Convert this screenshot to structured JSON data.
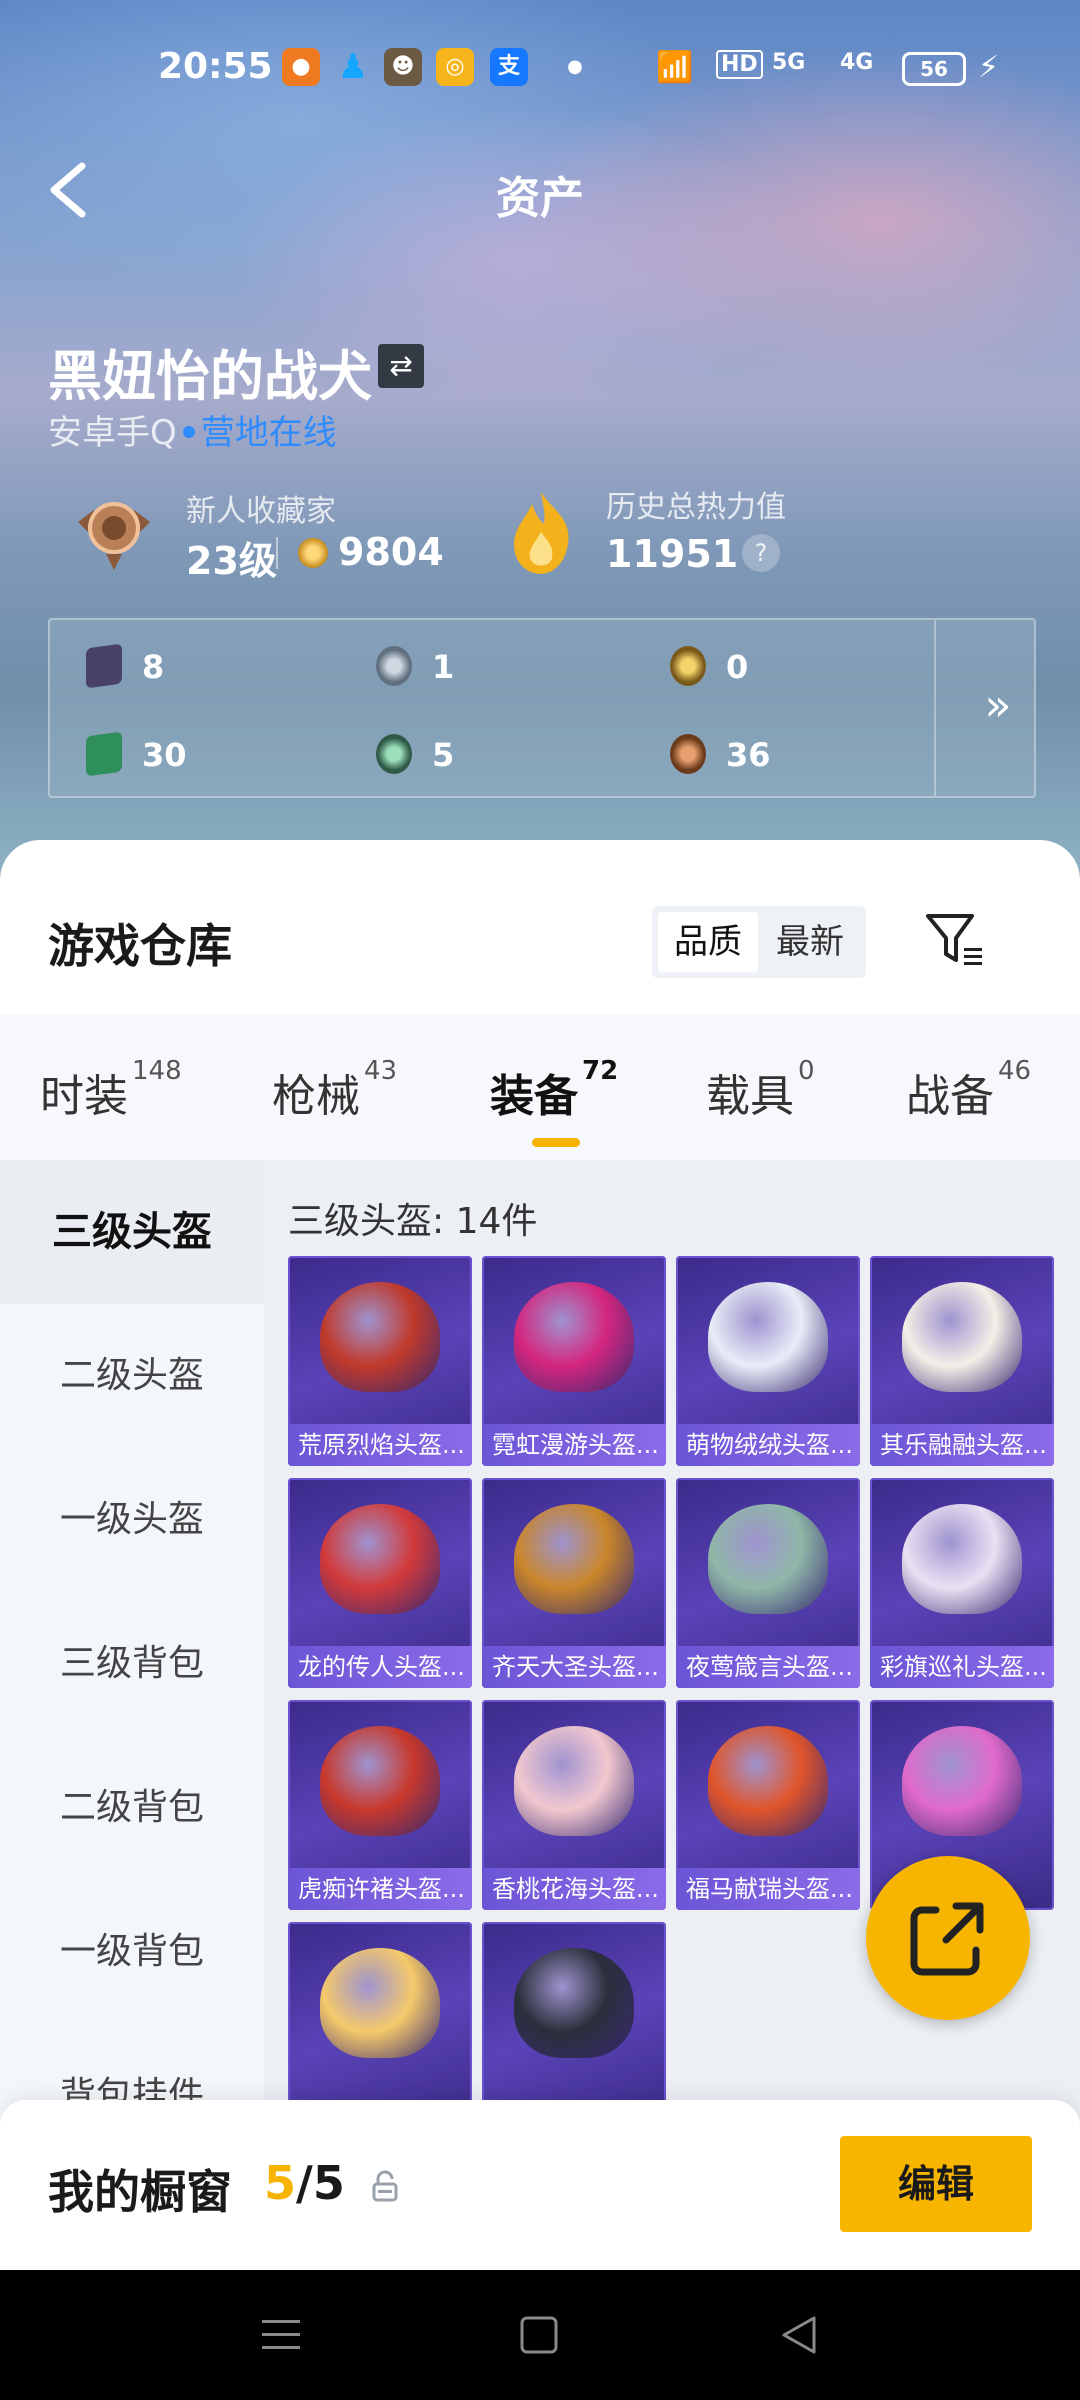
{
  "status": {
    "time": "20:55",
    "battery": "56",
    "network": [
      "HD",
      "5G",
      "4G"
    ]
  },
  "header": {
    "title": "资产",
    "back_icon": "back-arrow-icon"
  },
  "profile": {
    "username": "黑妞怡的战犬",
    "platform": "安卓手Q",
    "status": "营地在线",
    "rank_title": "新人收藏家",
    "rank_level": "23级",
    "rank_points": "9804",
    "heat_title": "历史总热力值",
    "heat_value": "11951",
    "help": "?"
  },
  "assets": [
    {
      "icon": "card-purple-icon",
      "value": "8",
      "color": "#4a4266"
    },
    {
      "icon": "coin-silver-icon",
      "value": "1",
      "color": "#5f6f80"
    },
    {
      "icon": "coin-gold-icon",
      "value": "0",
      "color": "#9a7a2a"
    },
    {
      "icon": "card-green-icon",
      "value": "30",
      "color": "#2f8f5a"
    },
    {
      "icon": "orb-green-icon",
      "value": "5",
      "color": "#3a8060"
    },
    {
      "icon": "coin-bronze-icon",
      "value": "36",
      "color": "#9a5a2a"
    }
  ],
  "warehouse": {
    "title": "游戏仓库",
    "sort": [
      "品质",
      "最新"
    ],
    "active_sort": "品质",
    "tabs": [
      {
        "label": "时装",
        "count": "148"
      },
      {
        "label": "枪械",
        "count": "43"
      },
      {
        "label": "装备",
        "count": "72"
      },
      {
        "label": "载具",
        "count": "0"
      },
      {
        "label": "战备",
        "count": "46"
      }
    ],
    "active_tab": "装备",
    "categories": [
      "三级头盔",
      "二级头盔",
      "一级头盔",
      "三级背包",
      "二级背包",
      "一级背包",
      "背包挂件"
    ],
    "active_category": "三级头盔",
    "grid_title": "三级头盔: 14件",
    "items": [
      {
        "label": "荒原烈焰头盔...",
        "color": "#c0392b"
      },
      {
        "label": "霓虹漫游头盔...",
        "color": "#d4267e"
      },
      {
        "label": "萌物绒绒头盔...",
        "color": "#e8edf6"
      },
      {
        "label": "其乐融融头盔...",
        "color": "#f3efe6"
      },
      {
        "label": "龙的传人头盔...",
        "color": "#d23a3a"
      },
      {
        "label": "齐天大圣头盔...",
        "color": "#c9862a"
      },
      {
        "label": "夜莺箴言头盔...",
        "color": "#8fb8a8"
      },
      {
        "label": "彩旗巡礼头盔...",
        "color": "#e9e1f2"
      },
      {
        "label": "虎痴许褚头盔...",
        "color": "#c8382c"
      },
      {
        "label": "香桃花海头盔...",
        "color": "#f2c8cf"
      },
      {
        "label": "福马献瑞头盔...",
        "color": "#e0552a"
      },
      {
        "label": "",
        "color": "#e06acb"
      },
      {
        "label": "",
        "color": "#f5c96a"
      },
      {
        "label": "",
        "color": "#2a2f3a"
      }
    ]
  },
  "showcase": {
    "title": "我的橱窗",
    "current": "5",
    "total": "/5",
    "edit": "编辑"
  }
}
